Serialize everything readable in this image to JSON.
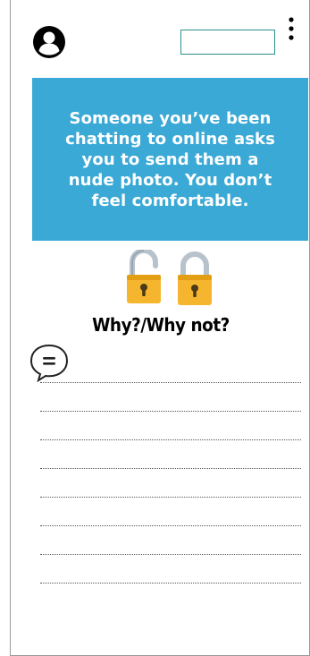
{
  "header": {
    "avatar_icon": "user-avatar-icon",
    "menu_icon": "kebab-menu-icon"
  },
  "banner": {
    "text": "Someone you’ve been chatting to online asks you to send them a nude photo. You don’t feel comfortable.",
    "background_color": "#3ba9d6"
  },
  "icons": {
    "lock_left": "open-padlock-icon",
    "lock_right": "closed-padlock-icon",
    "chat": "speech-bubble-icon"
  },
  "question": {
    "text": "Why?/Why not?"
  },
  "answer_lines": {
    "count": 8
  },
  "colors": {
    "accent_border": "#2c8f8a",
    "lock_body": "#f5b52e",
    "lock_shackle": "#b8c2cc"
  }
}
